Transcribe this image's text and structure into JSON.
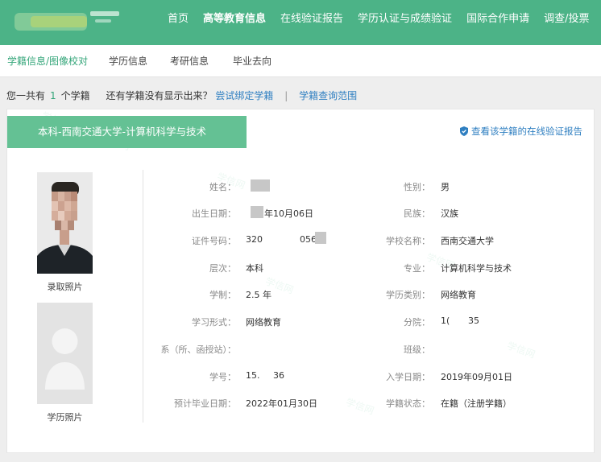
{
  "top_nav": {
    "items": [
      "首页",
      "高等教育信息",
      "在线验证报告",
      "学历认证与成绩验证",
      "国际合作申请",
      "调查/投票"
    ],
    "active": "高等教育信息"
  },
  "sub_nav": {
    "items": [
      "学籍信息/图像校对",
      "学历信息",
      "考研信息",
      "毕业去向"
    ],
    "active": "学籍信息/图像校对"
  },
  "summary": {
    "prefix": "您一共有",
    "count": "1",
    "suffix": "个学籍",
    "question": "还有学籍没有显示出来？",
    "bind_link": "尝试绑定学籍",
    "separator": "|",
    "scope_link": "学籍查询范围"
  },
  "record": {
    "title": "本科-西南交通大学-计算机科学与技术",
    "verify_link": "查看该学籍的在线验证报告",
    "photo_enroll_label": "录取照片",
    "photo_degree_label": "学历照片",
    "fields": {
      "name": {
        "label": "姓名：",
        "value": ""
      },
      "gender": {
        "label": "性别：",
        "value": "男"
      },
      "birth": {
        "label": "出生日期：",
        "value": "年10月06日"
      },
      "ethnicity": {
        "label": "民族：",
        "value": "汉族"
      },
      "id_number": {
        "label": "证件号码：",
        "value_a": "320",
        "value_b": "056"
      },
      "school": {
        "label": "学校名称：",
        "value": "西南交通大学"
      },
      "level": {
        "label": "层次：",
        "value": "本科"
      },
      "major": {
        "label": "专业：",
        "value": "计算机科学与技术"
      },
      "duration": {
        "label": "学制：",
        "value": "2.5 年"
      },
      "edu_type": {
        "label": "学历类别：",
        "value": "网络教育"
      },
      "study_form": {
        "label": "学习形式：",
        "value": "网络教育"
      },
      "branch": {
        "label": "分院：",
        "value_a": "1(",
        "value_b": "35"
      },
      "department": {
        "label": "系（所、函授站）：",
        "value": ""
      },
      "class": {
        "label": "班级：",
        "value": ""
      },
      "student_no": {
        "label": "学号：",
        "value_a": "15.",
        "value_b": "36"
      },
      "enroll_date": {
        "label": "入学日期：",
        "value": "2019年09月01日"
      },
      "grad_date": {
        "label": "预计毕业日期：",
        "value": "2022年01月30日"
      },
      "status": {
        "label": "学籍状态：",
        "value": "在籍（注册学籍）"
      }
    }
  },
  "colors": {
    "brand_green": "#4cb387",
    "title_green": "#64c194",
    "link_blue": "#2f7fc1",
    "active_sub": "#35a67a"
  }
}
